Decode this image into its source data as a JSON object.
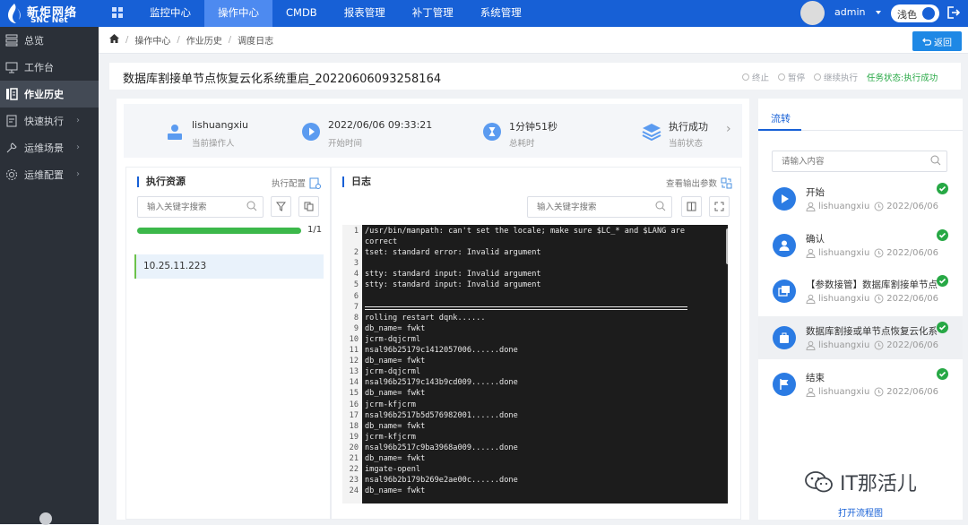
{
  "brand": {
    "name": "新炬网络",
    "sub": "SNC Net"
  },
  "nav": [
    {
      "label": "监控中心",
      "active": false
    },
    {
      "label": "操作中心",
      "active": true
    },
    {
      "label": "CMDB",
      "active": false
    },
    {
      "label": "报表管理",
      "active": false
    },
    {
      "label": "补丁管理",
      "active": false
    },
    {
      "label": "系统管理",
      "active": false
    }
  ],
  "user": {
    "name": "admin",
    "theme_label": "浅色"
  },
  "sidebar": [
    {
      "label": "总览",
      "icon": "overview-icon",
      "active": false,
      "arrow": false
    },
    {
      "label": "工作台",
      "icon": "monitor-icon",
      "active": false,
      "arrow": false
    },
    {
      "label": "作业历史",
      "icon": "history-icon",
      "active": true,
      "arrow": false
    },
    {
      "label": "快速执行",
      "icon": "quick-exec-icon",
      "active": false,
      "arrow": true
    },
    {
      "label": "运维场景",
      "icon": "scenario-icon",
      "active": false,
      "arrow": true
    },
    {
      "label": "运维配置",
      "icon": "settings-icon",
      "active": false,
      "arrow": true
    }
  ],
  "breadcrumb": [
    "操作中心",
    "作业历史",
    "调度日志"
  ],
  "back_label": "返回",
  "title": "数据库割接单节点恢复云化系统重启_20220606093258164",
  "actions": {
    "stop": "终止",
    "pause": "暂停",
    "resume": "继续执行",
    "status_prefix": "任务状态:",
    "status_value": "执行成功"
  },
  "summary": {
    "operator": {
      "value": "lishuangxiu",
      "label": "当前操作人"
    },
    "start": {
      "value": "2022/06/06 09:33:21",
      "label": "开始时间"
    },
    "duration": {
      "value": "1分钟51秒",
      "label": "总耗时"
    },
    "state": {
      "value": "执行成功",
      "label": "当前状态"
    }
  },
  "resources": {
    "title": "执行资源",
    "config_link": "执行配置",
    "search_placeholder": "输入关键字搜索",
    "progress_fraction": 1.0,
    "progress_label": "1/1",
    "hosts": [
      "10.25.11.223"
    ]
  },
  "log": {
    "title": "日志",
    "params_link": "查看输出参数",
    "search_placeholder": "输入关键字搜索",
    "lines": [
      {
        "n": "1",
        "t": "/usr/bin/manpath: can't set the locale; make sure $LC_* and $LANG are"
      },
      {
        "n": "",
        "t": "correct"
      },
      {
        "n": "2",
        "t": "tset: standard error: Invalid argument"
      },
      {
        "n": "3",
        "t": ""
      },
      {
        "n": "4",
        "t": "stty: standard input: Invalid argument"
      },
      {
        "n": "5",
        "t": "stty: standard input: Invalid argument"
      },
      {
        "n": "6",
        "t": ""
      },
      {
        "n": "7",
        "t": "",
        "sep": true
      },
      {
        "n": "8",
        "t": "rolling restart dqnk......"
      },
      {
        "n": "9",
        "t": "db_name= fwkt"
      },
      {
        "n": "10",
        "t": "jcrm-dqjcrml"
      },
      {
        "n": "11",
        "t": "nsal96b25179c1412057006......done"
      },
      {
        "n": "12",
        "t": "db_name= fwkt"
      },
      {
        "n": "13",
        "t": "jcrm-dqjcrml"
      },
      {
        "n": "14",
        "t": "nsal96b25179c143b9cd009......done"
      },
      {
        "n": "15",
        "t": "db_name= fwkt"
      },
      {
        "n": "16",
        "t": "jcrm-kfjcrm"
      },
      {
        "n": "17",
        "t": "nsal96b2517b5d576982001......done"
      },
      {
        "n": "18",
        "t": "db_name= fwkt"
      },
      {
        "n": "19",
        "t": "jcrm-kfjcrm"
      },
      {
        "n": "20",
        "t": "nsal96b2517c9ba3968a009......done"
      },
      {
        "n": "21",
        "t": "db_name= fwkt"
      },
      {
        "n": "22",
        "t": "imgate-openl"
      },
      {
        "n": "23",
        "t": "nsal96b2b179b269e2ae00c......done"
      },
      {
        "n": "24",
        "t": "db_name= fwkt"
      }
    ]
  },
  "flow": {
    "tab_label": "流转",
    "search_placeholder": "请输入内容",
    "steps": [
      {
        "name": "开始",
        "user": "lishuangxiu",
        "time": "2022/06/06",
        "icon": "play-icon",
        "active": false
      },
      {
        "name": "确认",
        "user": "lishuangxiu",
        "time": "2022/06/06",
        "icon": "user-confirm-icon",
        "active": false
      },
      {
        "name": "【参数接管】数据库割接单节点",
        "user": "lishuangxiu",
        "time": "2022/06/06",
        "icon": "param-icon",
        "active": false
      },
      {
        "name": "数据库割接或单节点恢复云化系",
        "user": "lishuangxiu",
        "time": "2022/06/06",
        "icon": "task-icon",
        "active": true
      },
      {
        "name": "结束",
        "user": "lishuangxiu",
        "time": "2022/06/06",
        "icon": "flag-icon",
        "active": false
      }
    ],
    "open_label": "打开流程图"
  },
  "watermark": "IT那活儿",
  "colors": {
    "topbar": "#1760d6",
    "sidebar": "#2b3038",
    "success": "#27a845",
    "progress": "#3cb84a"
  }
}
